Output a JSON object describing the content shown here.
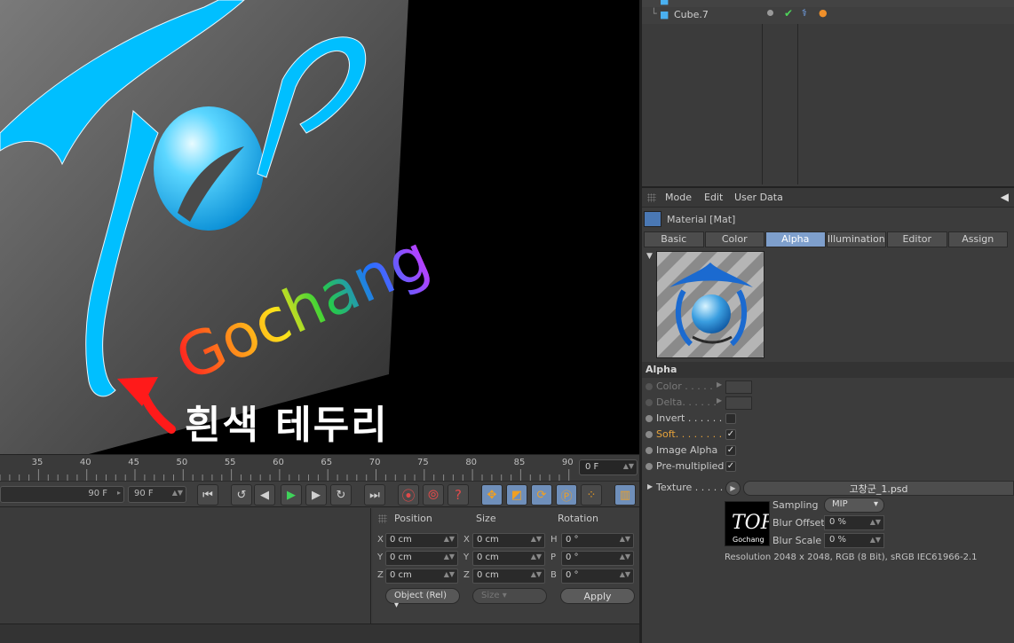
{
  "viewport": {
    "annotation": "흰색 테두리",
    "logo_word": "Gochang"
  },
  "timeline": {
    "ticks": [
      "35",
      "40",
      "45",
      "50",
      "55",
      "60",
      "65",
      "70",
      "75",
      "80",
      "85",
      "90"
    ],
    "current_frame": "0 F"
  },
  "transport": {
    "end_frame_a": "90 F",
    "end_frame_b": "90 F"
  },
  "coordinates": {
    "headers": {
      "position": "Position",
      "size": "Size",
      "rotation": "Rotation"
    },
    "rows": [
      {
        "axis1": "X",
        "pos": "0 cm",
        "axis2": "X",
        "size": "0 cm",
        "axis3": "H",
        "rot": "0 °"
      },
      {
        "axis1": "Y",
        "pos": "0 cm",
        "axis2": "Y",
        "size": "0 cm",
        "axis3": "P",
        "rot": "0 °"
      },
      {
        "axis1": "Z",
        "pos": "0 cm",
        "axis2": "Z",
        "size": "0 cm",
        "axis3": "B",
        "rot": "0 °"
      }
    ],
    "mode_combo": "Object (Rel)",
    "size_combo": "Size",
    "apply": "Apply"
  },
  "object_manager": {
    "items": [
      {
        "name": "Cube.7"
      }
    ]
  },
  "attributes": {
    "menu": [
      "Mode",
      "Edit",
      "User Data"
    ],
    "title": "Material [Mat]",
    "tabs": [
      {
        "label": "Basic",
        "active": false
      },
      {
        "label": "Color",
        "active": false
      },
      {
        "label": "Alpha",
        "active": true
      },
      {
        "label": "Illumination",
        "active": false
      },
      {
        "label": "Editor",
        "active": false
      },
      {
        "label": "Assign",
        "active": false
      }
    ],
    "section": "Alpha",
    "props": {
      "color": "Color . . . . .",
      "delta": "Delta. . . . . .",
      "invert": "Invert . . . . . . .",
      "soft": "Soft. . . . . . . . .",
      "image_alpha": "Image Alpha",
      "premultiplied": "Pre-multiplied"
    },
    "texture": {
      "label": "Texture . . . . . .",
      "file": "고창군_1.psd",
      "sampling_label": "Sampling",
      "sampling_value": "MIP",
      "blur_offset_label": "Blur Offset",
      "blur_offset_value": "0 %",
      "blur_scale_label": "Blur Scale",
      "blur_scale_value": "0 %",
      "resolution": "Resolution 2048 x 2048, RGB (8 Bit), sRGB IEC61966-2.1",
      "thumb_top": "TOP",
      "thumb_sub": "Gochang"
    }
  },
  "colors": {
    "logo_cyan": "#00bfff",
    "active_tab": "#7e9fcc",
    "soft_label": "#e6a23a"
  }
}
